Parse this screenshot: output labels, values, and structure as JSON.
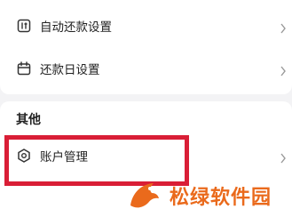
{
  "settings": {
    "auto_repay_label": "自动还款设置",
    "repay_day_label": "还款日设置"
  },
  "other": {
    "section_title": "其他",
    "account_label": "账户管理"
  },
  "watermark": {
    "text": "松绿软件园"
  },
  "icons": {
    "auto_repay": "auto-repay-icon",
    "repay_day": "calendar-icon",
    "account": "shield-icon",
    "chevron": "chevron-right-icon"
  },
  "colors": {
    "highlight": "#d91e36",
    "watermark": "#ea6a1c"
  }
}
